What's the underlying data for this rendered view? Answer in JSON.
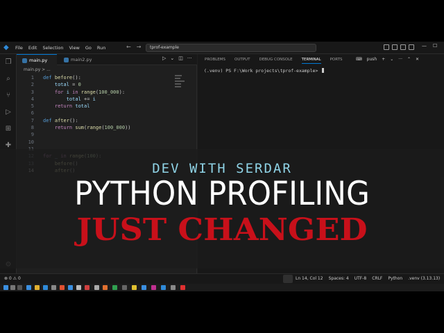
{
  "menu": [
    "File",
    "Edit",
    "Selection",
    "View",
    "Go",
    "Run"
  ],
  "search": {
    "text": "tprof-example"
  },
  "tabs": [
    {
      "label": "main.py"
    },
    {
      "label": "main2.py"
    }
  ],
  "breadcrumb": "main.py > ...",
  "code": [
    {
      "n": "1",
      "parts": [
        [
          "kw",
          "def "
        ],
        [
          "fn",
          "before"
        ],
        [
          "",
          "():"
        ]
      ]
    },
    {
      "n": "2",
      "parts": [
        [
          "",
          "    "
        ],
        [
          "var",
          "total"
        ],
        [
          "",
          " = "
        ],
        [
          "num",
          "0"
        ]
      ]
    },
    {
      "n": "3",
      "parts": [
        [
          "",
          "    "
        ],
        [
          "kw2",
          "for "
        ],
        [
          "var",
          "i"
        ],
        [
          "kw2",
          " in "
        ],
        [
          "fn",
          "range"
        ],
        [
          "",
          "("
        ],
        [
          "num",
          "100_000"
        ],
        [
          "",
          "):"
        ]
      ]
    },
    {
      "n": "4",
      "parts": [
        [
          "",
          "        "
        ],
        [
          "var",
          "total"
        ],
        [
          "",
          " += "
        ],
        [
          "var",
          "i"
        ]
      ]
    },
    {
      "n": "5",
      "parts": [
        [
          "",
          "    "
        ],
        [
          "kw2",
          "return "
        ],
        [
          "var",
          "total"
        ]
      ]
    },
    {
      "n": "6",
      "parts": []
    },
    {
      "n": "7",
      "parts": [
        [
          "kw",
          "def "
        ],
        [
          "fn",
          "after"
        ],
        [
          "",
          "():"
        ]
      ]
    },
    {
      "n": "8",
      "parts": [
        [
          "",
          "    "
        ],
        [
          "kw2",
          "return "
        ],
        [
          "fn",
          "sum"
        ],
        [
          "",
          "("
        ],
        [
          "fn",
          "range"
        ],
        [
          "",
          "("
        ],
        [
          "num",
          "100_000"
        ],
        [
          "",
          "))"
        ]
      ]
    },
    {
      "n": "9",
      "parts": []
    },
    {
      "n": "10",
      "parts": []
    },
    {
      "n": "11",
      "parts": []
    },
    {
      "n": "12",
      "parts": [
        [
          "kw2",
          "for "
        ],
        [
          "var",
          "_"
        ],
        [
          "kw2",
          " in "
        ],
        [
          "fn",
          "range"
        ],
        [
          "",
          "("
        ],
        [
          "num",
          "100"
        ],
        [
          "",
          "):"
        ]
      ]
    },
    {
      "n": "13",
      "parts": [
        [
          "",
          "    "
        ],
        [
          "fn",
          "before"
        ],
        [
          "",
          "()"
        ]
      ]
    },
    {
      "n": "14",
      "parts": [
        [
          "",
          "    "
        ],
        [
          "fn",
          "after"
        ],
        [
          "",
          "()"
        ]
      ]
    }
  ],
  "panel_tabs": [
    "PROBLEMS",
    "OUTPUT",
    "DEBUG CONSOLE",
    "TERMINAL",
    "PORTS"
  ],
  "panel_active": "TERMINAL",
  "terminal": {
    "shell": "push",
    "prompt": "(.venv) PS F:\\Work projects\\tprof-example> "
  },
  "status": {
    "problems": "⊗ 0  ⚠ 0",
    "position": "Ln 14, Col 12",
    "spaces": "Spaces: 4",
    "encoding": "UTF-8",
    "eol": "CRLF",
    "language": "Python",
    "interpreter": ".venv (3.13.13)"
  },
  "banner": {
    "subtitle": "DEV WITH SERDAR",
    "title": "PYTHON PROFILING",
    "subtitle2": "JUST CHANGED"
  },
  "colors": {
    "accent": "#0078d4",
    "banner_cyan": "#8fd3e6",
    "banner_red": "#c8101a"
  }
}
